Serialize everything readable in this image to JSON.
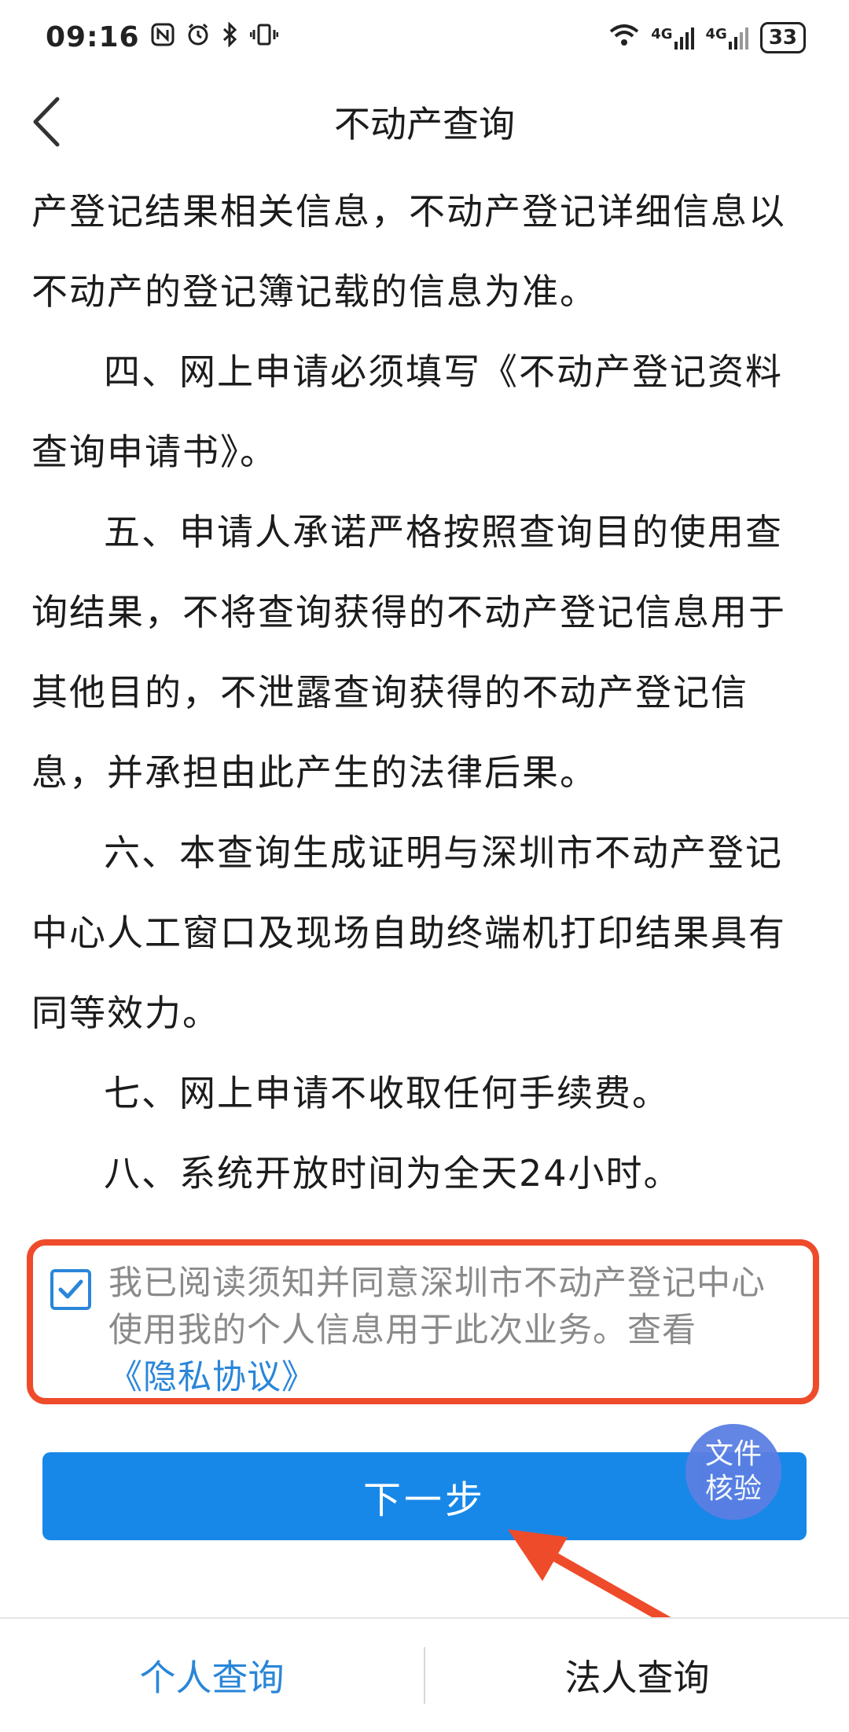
{
  "status_bar": {
    "time": "09:16",
    "left_icons": [
      "nfc-icon",
      "alarm-icon",
      "bluetooth-icon",
      "vibrate-icon"
    ],
    "network_1": "4G",
    "network_2": "4G",
    "battery": "33"
  },
  "nav": {
    "title": "不动产查询"
  },
  "content": {
    "paragraphs": [
      {
        "text": "产登记结果相关信息，不动产登记详细信息以不动产的登记簿记载的信息为准。",
        "indent": false
      },
      {
        "text": "四、网上申请必须填写《不动产登记资料查询申请书》。",
        "indent": true
      },
      {
        "text": "五、申请人承诺严格按照查询目的使用查询结果，不将查询获得的不动产登记信息用于其他目的，不泄露查询获得的不动产登记信息，并承担由此产生的法律后果。",
        "indent": true
      },
      {
        "text": "六、本查询生成证明与深圳市不动产登记中心人工窗口及现场自助终端机打印结果具有同等效力。",
        "indent": true
      },
      {
        "text": "七、网上申请不收取任何手续费。",
        "indent": true
      },
      {
        "text": "八、系统开放时间为全天24小时。",
        "indent": true
      }
    ]
  },
  "agreement": {
    "checked": true,
    "text": "我已阅读须知并同意深圳市不动产登记中心使用我的个人信息用于此次业务。查看",
    "link": "《隐私协议》"
  },
  "next_button": {
    "label": "下一步"
  },
  "float_badge": {
    "line1": "文件",
    "line2": "核验"
  },
  "tabs": {
    "personal": "个人查询",
    "legal": "法人查询",
    "active": "personal"
  },
  "colors": {
    "accent": "#1888e8",
    "link": "#2a86d8",
    "highlight": "#ee4b2b",
    "badge": "#5b7fe3"
  }
}
